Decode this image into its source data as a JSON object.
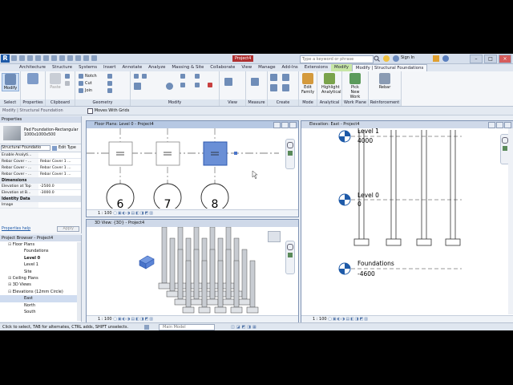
{
  "titlebar": {
    "project": "Project4",
    "search_placeholder": "Type a keyword or phrase",
    "sign_in": "Sign In"
  },
  "tabs": [
    "Architecture",
    "Structure",
    "Systems",
    "Insert",
    "Annotate",
    "Analyze",
    "Massing & Site",
    "Collaborate",
    "View",
    "Manage",
    "Add-Ins",
    "Extensions",
    "Modify",
    "Modify | Structural Foundations"
  ],
  "ribbon": {
    "select": {
      "modify": "Modify",
      "label": "Select"
    },
    "properties": {
      "label": "Properties"
    },
    "clipboard": {
      "paste": "Paste",
      "label": "Clipboard"
    },
    "geometry": {
      "notch": "Notch",
      "cut": "Cut",
      "join": "Join",
      "label": "Geometry"
    },
    "modify": {
      "label": "Modify"
    },
    "view": {
      "label": "View"
    },
    "measure": {
      "label": "Measure"
    },
    "create": {
      "label": "Create"
    },
    "mode": {
      "edit_family": "Edit Family",
      "label": "Mode"
    },
    "analytical": {
      "highlight": "Highlight Analytical",
      "label": "Analytical"
    },
    "work_plane": {
      "pick": "Pick New Work Plane",
      "label": "Work Plane"
    },
    "reinforcement": {
      "rebar": "Rebar",
      "label": "Reinforcement"
    }
  },
  "options_bar": {
    "modify_ctx": "Modify | Structural Foundation",
    "moves_with_grids": "Moves With Grids"
  },
  "properties": {
    "title": "Properties",
    "family": "Pad Foundation-Rectangular",
    "type": "1000x1000x500",
    "selector": "Structural Foundatio",
    "edit_type": "Edit Type",
    "rows": [
      {
        "k": "Enable Analyti...",
        "v": ""
      },
      {
        "k": "Rebar Cover - ...",
        "v": "Rebar Cover 1 ..."
      },
      {
        "k": "Rebar Cover - ...",
        "v": "Rebar Cover 1 ..."
      },
      {
        "k": "Rebar Cover - ...",
        "v": "Rebar Cover 1 ..."
      }
    ],
    "dimensions_label": "Dimensions",
    "dim_rows": [
      {
        "k": "Elevation at Top",
        "v": "-2500.0"
      },
      {
        "k": "Elevation at B...",
        "v": "-3000.0"
      }
    ],
    "identity_label": "Identity Data",
    "image_row": "Image",
    "help": "Properties help",
    "apply": "Apply"
  },
  "browser": {
    "title": "Project Browser - Project4",
    "items": [
      "Floor Plans",
      "Foundations",
      "Level 0",
      "Level 1",
      "Site",
      "Ceiling Plans",
      "3D Views",
      "Elevations (12mm Circle)",
      "East",
      "North",
      "South"
    ]
  },
  "views": {
    "plan": {
      "title": "Floor Plans: Level 0 - Project4",
      "scale": "1 : 100",
      "grids": [
        "6",
        "7",
        "8"
      ]
    },
    "threed": {
      "title": "3D View: {3D} - Project4",
      "scale": "1 : 100"
    },
    "elev": {
      "title": "Elevation: East - Project4",
      "scale": "1 : 100",
      "levels": [
        {
          "name": "Level 1",
          "value": "4000"
        },
        {
          "name": "Level 0",
          "value": "0"
        },
        {
          "name": "Foundations",
          "value": "-4600"
        }
      ]
    }
  },
  "status": {
    "hint": "Click to select, TAB for alternates, CTRL adds, SHIFT unselects.",
    "model": "Main Model"
  },
  "colors": {
    "selected": "#6a8fd6",
    "ctx_tab": "#c7e6a5"
  }
}
